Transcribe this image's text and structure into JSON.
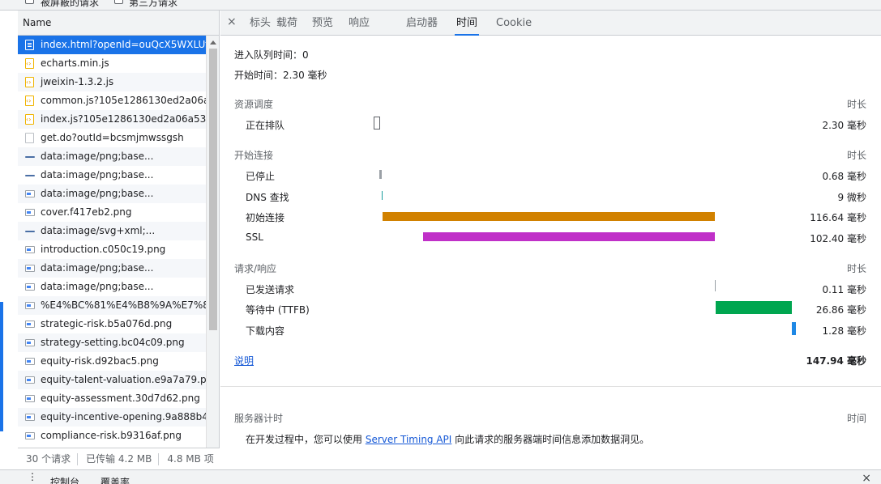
{
  "topbar": {
    "checkbox1_label": "被屏蔽的请求",
    "checkbox2_label": "第三方请求"
  },
  "request_list": {
    "column_header": "Name",
    "rows": [
      {
        "name": "index.html?openId=ouQcX5WXLUf",
        "type": "doc",
        "selected": true
      },
      {
        "name": "echarts.min.js",
        "type": "js"
      },
      {
        "name": "jweixin-1.3.2.js",
        "type": "js"
      },
      {
        "name": "common.js?105e1286130ed2a06a5",
        "type": "js"
      },
      {
        "name": "index.js?105e1286130ed2a06a53",
        "type": "js"
      },
      {
        "name": "get.do?outId=bcsmjmwssgsh",
        "type": "blank"
      },
      {
        "name": "data:image/png;base...",
        "type": "line"
      },
      {
        "name": "data:image/png;base...",
        "type": "line"
      },
      {
        "name": "data:image/png;base...",
        "type": "img"
      },
      {
        "name": "cover.f417eb2.png",
        "type": "img"
      },
      {
        "name": "data:image/svg+xml;...",
        "type": "line"
      },
      {
        "name": "introduction.c050c19.png",
        "type": "img"
      },
      {
        "name": "data:image/png;base...",
        "type": "img"
      },
      {
        "name": "data:image/png;base...",
        "type": "img"
      },
      {
        "name": "%E4%BC%81%E4%B8%9A%E7%8E",
        "type": "img"
      },
      {
        "name": "strategic-risk.b5a076d.png",
        "type": "img"
      },
      {
        "name": "strategy-setting.bc04c09.png",
        "type": "img"
      },
      {
        "name": "equity-risk.d92bac5.png",
        "type": "img"
      },
      {
        "name": "equity-talent-valuation.e9a7a79.pn",
        "type": "img"
      },
      {
        "name": "equity-assessment.30d7d62.png",
        "type": "img"
      },
      {
        "name": "equity-incentive-opening.9a888b4.",
        "type": "img"
      },
      {
        "name": "compliance-risk.b9316af.png",
        "type": "img"
      }
    ],
    "status": {
      "requests": "30 个请求",
      "transferred": "已传输 4.2 MB",
      "resources": "4.8 MB 项"
    }
  },
  "detail_tabs": {
    "close": "×",
    "items": [
      "标头",
      "载荷",
      "预览",
      "响应",
      "启动器",
      "时间",
      "Cookie"
    ],
    "active": "时间"
  },
  "timing": {
    "queued_at": "进入队列时间：0",
    "started_at": "开始时间：2.30 毫秒",
    "sections": {
      "resource_scheduling": {
        "title": "资源调度",
        "duration_header": "时长"
      },
      "connection_start": {
        "title": "开始连接",
        "duration_header": "时长"
      },
      "request_response": {
        "title": "请求/响应",
        "duration_header": "时长"
      }
    },
    "rows": {
      "queueing": {
        "label": "正在排队",
        "value": "2.30 毫秒"
      },
      "stalled": {
        "label": "已停止",
        "value": "0.68 毫秒",
        "color": "#9aa0a6"
      },
      "dns": {
        "label": "DNS 查找",
        "value": "9 微秒",
        "color": "#1a9e9e"
      },
      "initial_connection": {
        "label": "初始连接",
        "value": "116.64 毫秒",
        "color": "#d18100"
      },
      "ssl": {
        "label": "SSL",
        "value": "102.40 毫秒",
        "color": "#c030c8"
      },
      "request_sent": {
        "label": "已发送请求",
        "value": "0.11 毫秒",
        "color": "#9aa0a6"
      },
      "waiting": {
        "label": "等待中 (TTFB)",
        "value": "26.86 毫秒",
        "color": "#00a650"
      },
      "content_download": {
        "label": "下载内容",
        "value": "1.28 毫秒",
        "color": "#1e88e5"
      }
    },
    "explanation_link": "说明",
    "total": "147.94 毫秒",
    "server_timing": {
      "title": "服务器计时",
      "time_header": "时间",
      "text_before": "在开发过程中，您可以使用 ",
      "link": "Server Timing API",
      "text_after": " 向此请求的服务器端时间信息添加数据洞见。"
    }
  },
  "drawer": {
    "tab1": "控制台",
    "tab2": "覆盖率",
    "close": "×"
  }
}
